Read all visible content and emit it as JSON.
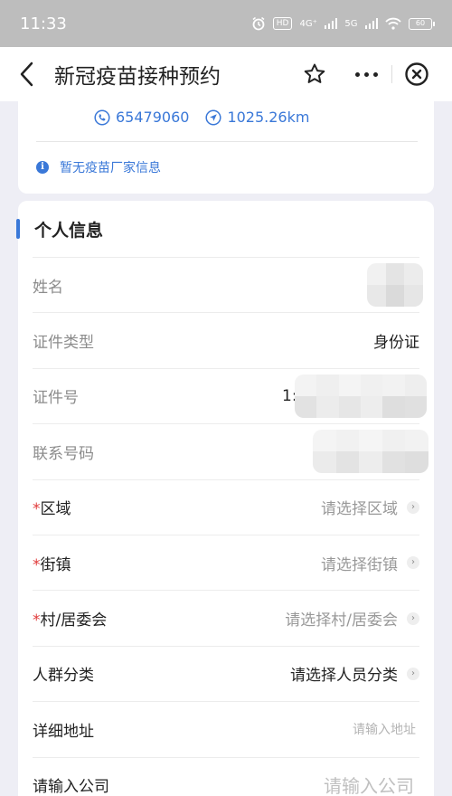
{
  "status_bar": {
    "time": "11:33",
    "hd_label": "HD",
    "net_4g": "4G⁺",
    "net_5g": "5G",
    "battery": "60",
    "icons": [
      "alarm-icon",
      "signal-icon",
      "wifi-icon",
      "battery-icon"
    ]
  },
  "nav": {
    "title": "新冠疫苗接种预约",
    "icons": [
      "back-arrow-icon",
      "star-icon",
      "more-icon",
      "close-icon"
    ]
  },
  "top_card": {
    "phone": "65479060",
    "distance": "1025.26km",
    "notice": "暂无疫苗厂家信息",
    "accent": "#3a78d8"
  },
  "section": {
    "title": "个人信息"
  },
  "fields": {
    "name": {
      "label": "姓名"
    },
    "id_type": {
      "label": "证件类型",
      "value": "身份证"
    },
    "id_number": {
      "label": "证件号",
      "partial": "1:"
    },
    "phone": {
      "label": "联系号码"
    },
    "district": {
      "required": "*",
      "label": "区域",
      "placeholder": "请选择区域"
    },
    "street": {
      "required": "*",
      "label": "街镇",
      "placeholder": "请选择街镇"
    },
    "village": {
      "required": "*",
      "label": "村/居委会",
      "placeholder": "请选择村/居委会"
    },
    "group": {
      "label": "人群分类",
      "value": "请选择人员分类"
    },
    "address": {
      "label": "详细地址",
      "placeholder": "请输入地址"
    },
    "company": {
      "label": "请输入公司",
      "placeholder": "请输入公司"
    }
  },
  "colors": {
    "accent": "#3a78d8",
    "required": "#e03a3a",
    "status_bar": "#bdbdbd",
    "page_bg": "#eeeef5"
  }
}
